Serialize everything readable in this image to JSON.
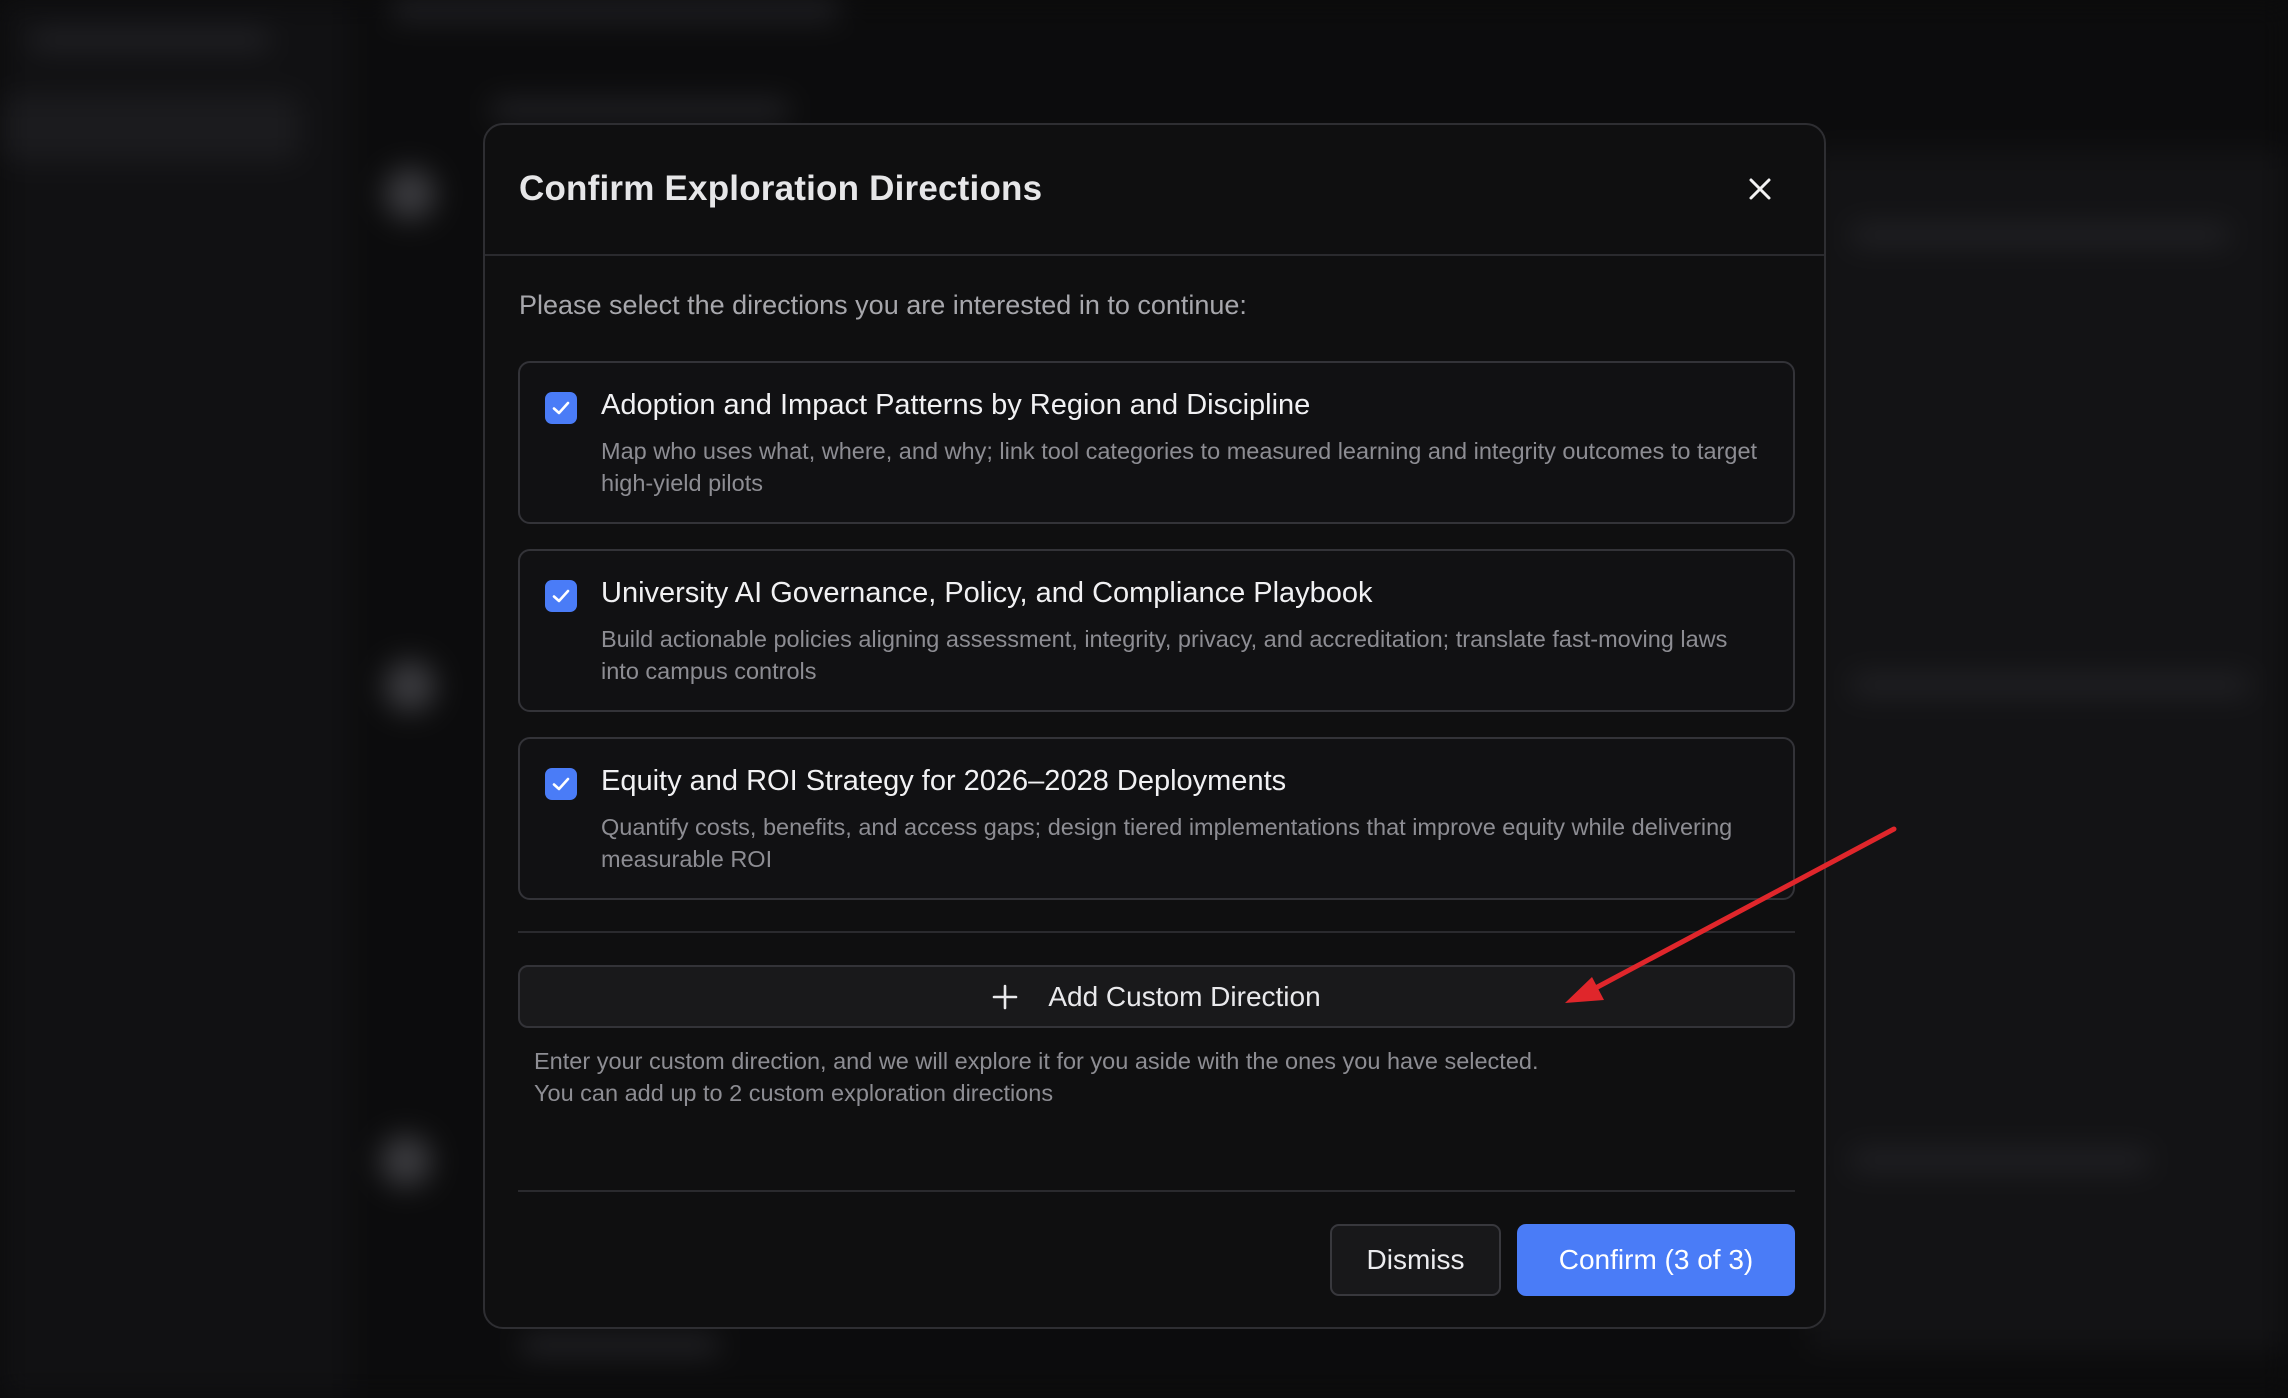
{
  "modal": {
    "title": "Confirm Exploration Directions",
    "intro": "Please select the directions you are interested in to continue:",
    "directions": [
      {
        "checked": true,
        "title": "Adoption and Impact Patterns by Region and Discipline",
        "description": "Map who uses what, where, and why; link tool categories to measured learning and integrity outcomes to target high-yield pilots"
      },
      {
        "checked": true,
        "title": "University AI Governance, Policy, and Compliance Playbook",
        "description": "Build actionable policies aligning assessment, integrity, privacy, and accreditation; translate fast-moving laws into campus controls"
      },
      {
        "checked": true,
        "title": "Equity and ROI Strategy for 2026–2028 Deployments",
        "description": "Quantify costs, benefits, and access gaps; design tiered implementations that improve equity while delivering measurable ROI"
      }
    ],
    "add_custom_label": "Add Custom Direction",
    "help_line_1": "Enter your custom direction, and we will explore it for you aside with the ones you have selected.",
    "help_line_2": "You can add up to 2 custom exploration directions",
    "dismiss_label": "Dismiss",
    "confirm_label": "Confirm (3 of 3)"
  },
  "colors": {
    "accent": "#4a7cf7",
    "annotation_arrow": "#e0262b",
    "modal_bg": "#0f0f10",
    "border": "#333338"
  },
  "icons": {
    "close": "close-icon",
    "check": "check-icon",
    "plus": "plus-icon",
    "arrow": "annotation-arrow-icon"
  }
}
